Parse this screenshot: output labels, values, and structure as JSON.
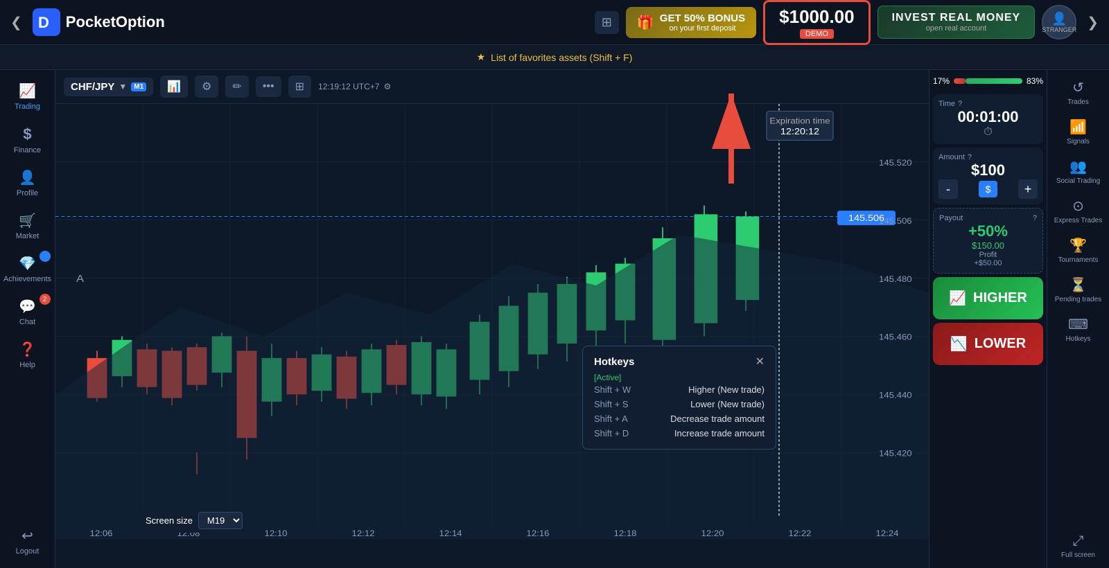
{
  "header": {
    "logo_text_normal": "Pocket",
    "logo_text_bold": "Option",
    "bonus_btn": {
      "label_line1": "GET 50% BONUS",
      "label_line2": "on your first deposit"
    },
    "demo_balance": "$1000.00",
    "demo_label": "DEMO",
    "invest_title": "INVEST REAL MONEY",
    "invest_sub": "open real account",
    "avatar_label": "STRANGER",
    "nav_left": "❮",
    "nav_right": "❯"
  },
  "favorites_bar": {
    "icon": "★",
    "text": "List of favorites assets (Shift + F)"
  },
  "sidebar_left": {
    "items": [
      {
        "id": "trading",
        "icon": "📈",
        "label": "Trading",
        "active": true
      },
      {
        "id": "finance",
        "icon": "$",
        "label": "Finance"
      },
      {
        "id": "profile",
        "icon": "👤",
        "label": "Profile"
      },
      {
        "id": "market",
        "icon": "🛒",
        "label": "Market"
      },
      {
        "id": "achievements",
        "icon": "💎",
        "label": "Achievements",
        "badge": ""
      },
      {
        "id": "chat",
        "icon": "💬",
        "label": "Chat",
        "badge": "2"
      },
      {
        "id": "help",
        "icon": "❓",
        "label": "Help"
      }
    ],
    "logout_label": "Logout",
    "logout_icon": "↩"
  },
  "chart": {
    "asset": "CHF/JPY",
    "timeframe": "M1",
    "time_display": "12:19:12 UTC+7",
    "current_price": "145.506",
    "expiration_time": "12:20:12",
    "expiration_label": "Expiration time",
    "price_levels": [
      "145.520",
      "145.506",
      "145.480",
      "145.460",
      "145.440",
      "145.420"
    ],
    "x_labels": [
      "12:06",
      "12:08",
      "12:10",
      "12:12",
      "12:14",
      "12:16",
      "12:18",
      "12:20",
      "12:22",
      "12:24"
    ],
    "screen_size_label": "Screen size",
    "screen_size_value": "M19"
  },
  "trading_panel": {
    "progress_left_pct": 17,
    "progress_right_pct": 83,
    "progress_left_label": "17%",
    "progress_right_label": "83%",
    "time_label": "Time",
    "time_value": "00:01:00",
    "amount_label": "Amount",
    "amount_value": "$100",
    "payout_label": "Payout",
    "payout_pct": "+50%",
    "payout_profit_label": "$150.00",
    "payout_profit_sub": "Profit",
    "payout_profit_amount": "+$50.00",
    "higher_btn": "HIGHER",
    "lower_btn": "LOWER"
  },
  "sidebar_right": {
    "items": [
      {
        "id": "trades",
        "icon": "↺",
        "label": "Trades"
      },
      {
        "id": "signals",
        "icon": "📶",
        "label": "Signals"
      },
      {
        "id": "social-trading",
        "icon": "👥",
        "label": "Social Trading"
      },
      {
        "id": "express-trades",
        "icon": "⊙",
        "label": "Express Trades"
      },
      {
        "id": "tournaments",
        "icon": "🏆",
        "label": "Tournaments"
      },
      {
        "id": "pending-trades",
        "icon": "⏳",
        "label": "Pending trades"
      },
      {
        "id": "hotkeys",
        "icon": "⌨",
        "label": "Hotkeys"
      },
      {
        "id": "full-screen",
        "icon": "⤢",
        "label": "Full screen"
      }
    ]
  },
  "hotkeys_popup": {
    "title": "Hotkeys",
    "status": "[Active]",
    "shortcuts": [
      {
        "key": "Shift + W",
        "desc": "Higher (New trade)"
      },
      {
        "key": "Shift + S",
        "desc": "Lower (New trade)"
      },
      {
        "key": "Shift + A",
        "desc": "Decrease trade amount"
      },
      {
        "key": "Shift + D",
        "desc": "Increase trade amount"
      }
    ]
  }
}
